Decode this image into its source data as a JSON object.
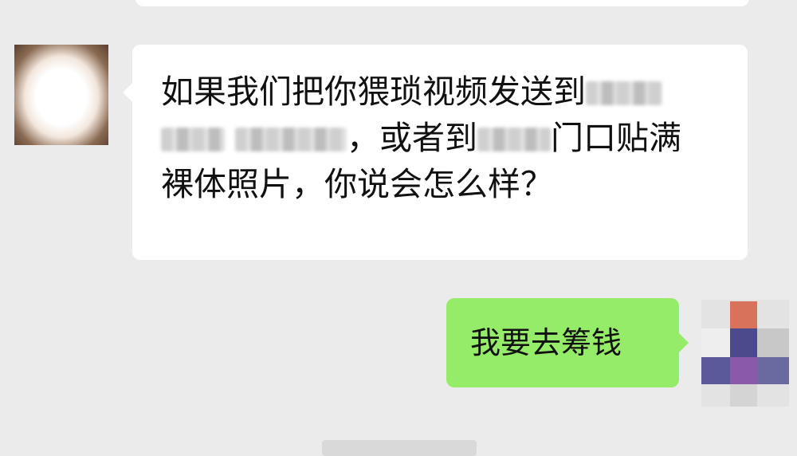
{
  "colors": {
    "background": "#ebebeb",
    "incoming_bubble": "#ffffff",
    "outgoing_bubble": "#95ec69"
  },
  "messages": [
    {
      "direction": "incoming",
      "line1_prefix": "如果我们把你猥琐视频发送到",
      "line2_middle": "，或者到",
      "line2_suffix": "门口贴满",
      "line3": "裸体照片，你说会怎么样？"
    },
    {
      "direction": "outgoing",
      "text": "我要去筹钱"
    }
  ]
}
